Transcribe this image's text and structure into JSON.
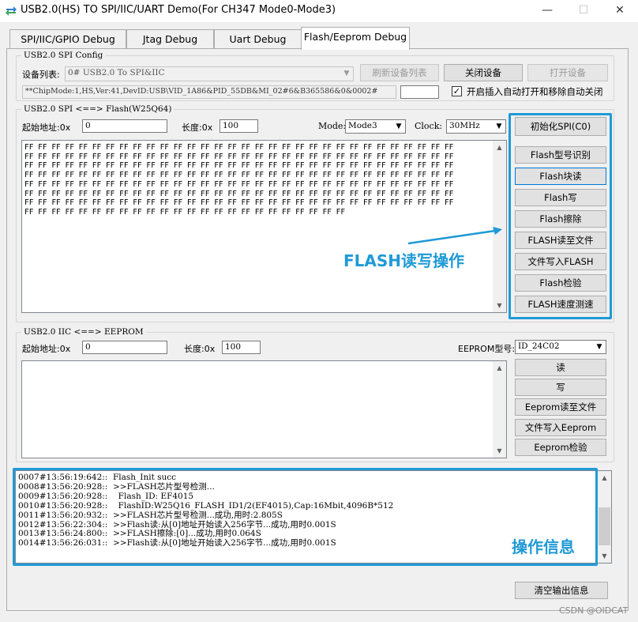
{
  "window": {
    "title": "USB2.0(HS) TO SPI/IIC/UART Demo(For CH347 Mode0-Mode3)",
    "minimize_glyph": "—",
    "maximize_glyph": "☐",
    "close_glyph": "✕"
  },
  "tabs": [
    {
      "label": "SPI/IIC/GPIO Debug",
      "active": false
    },
    {
      "label": "Jtag Debug",
      "active": false
    },
    {
      "label": "Uart Debug",
      "active": false
    },
    {
      "label": "Flash/Eeprom Debug",
      "active": true
    }
  ],
  "spi_config": {
    "group_title": "USB2.0 SPI Config",
    "device_list_label": "设备列表:",
    "device_selected": "0# USB2.0 To SPI&IIC",
    "refresh_button": "刷新设备列表",
    "close_button": "关闭设备",
    "open_button": "打开设备",
    "device_info": "**ChipMode:1,HS,Ver:41,DevID:USB\\VID_1A86&PID_55DB&MI_02#6&B365586&0&0002#",
    "device_info_extra": "",
    "auto_open_checked": true,
    "auto_open_label": "开启插入自动打开和移除自动关闭"
  },
  "spi_flash": {
    "group_title": "USB2.0 SPI <==> Flash(W25Q64)",
    "start_addr_label": "起始地址:0x",
    "start_addr_value": "0",
    "length_label": "长度:0x",
    "length_value": "100",
    "mode_label": "Mode:",
    "mode_value": "Mode3",
    "clock_label": "Clock:",
    "clock_value": "30MHz",
    "data_lines": [
      "FF FF FF FF FF FF FF FF FF FF FF FF FF FF FF FF FF FF FF FF FF FF FF FF FF FF FF FF FF FF FF FF",
      "FF FF FF FF FF FF FF FF FF FF FF FF FF FF FF FF FF FF FF FF FF FF FF FF FF FF FF FF FF FF FF FF",
      "FF FF FF FF FF FF FF FF FF FF FF FF FF FF FF FF FF FF FF FF FF FF FF FF FF FF FF FF FF FF FF FF",
      "FF FF FF FF FF FF FF FF FF FF FF FF FF FF FF FF FF FF FF FF FF FF FF FF FF FF FF FF FF FF FF FF",
      "FF FF FF FF FF FF FF FF FF FF FF FF FF FF FF FF FF FF FF FF FF FF FF FF FF FF FF FF FF FF FF FF",
      "FF FF FF FF FF FF FF FF FF FF FF FF FF FF FF FF FF FF FF FF FF FF FF FF FF FF FF FF FF FF FF FF",
      "FF FF FF FF FF FF FF FF FF FF FF FF FF FF FF FF FF FF FF FF FF FF FF FF FF FF FF FF FF FF FF FF",
      "FF FF FF FF FF FF FF FF FF FF FF FF FF FF FF FF FF FF FF FF FF FF FF FF"
    ],
    "buttons": [
      "初始化SPI(C0)",
      "Flash型号识别",
      "Flash块读",
      "Flash写",
      "Flash擦除",
      "FLASH读至文件",
      "文件写入FLASH",
      "Flash检验",
      "FLASH速度测速"
    ],
    "annotation": "FLASH读写操作"
  },
  "iic_eeprom": {
    "group_title": "USB2.0 IIC <==> EEPROM",
    "start_addr_label": "起始地址:0x",
    "start_addr_value": "0",
    "length_label": "长度:0x",
    "length_value": "100",
    "type_label": "EEPROM型号:",
    "type_value": "ID_24C02",
    "buttons": [
      "读",
      "写",
      "Eeprom读至文件",
      "文件写入Eeprom",
      "Eeprom检验"
    ]
  },
  "log": {
    "lines": [
      "0007#13:56:19:642::  Flash_Init succ",
      "0008#13:56:20:928::  >>FLASH芯片型号检测...",
      "0009#13:56:20:928::    Flash_ID: EF4015",
      "0010#13:56:20:928::    FlashID:W25Q16_FLASH_ID1/2(EF4015),Cap:16Mbit,4096B*512",
      "0011#13:56:20:932::  >>FLASH芯片型号检测...成功,用时:2.805S",
      "0012#13:56:22:304::  >>Flash读:从[0]地址开始读入256字节...成功,用时0.001S",
      "0013#13:56:24:800::  >>FLASH擦除:[0]...成功,用时0.064S",
      "0014#13:56:26:031::  >>Flash读:从[0]地址开始读入256字节...成功,用时0.001S"
    ],
    "annotation": "操作信息",
    "clear_button": "清空输出信息"
  },
  "watermark": "CSDN @OIDCAT",
  "colors": {
    "highlight": "#1f9ad6",
    "window_bg": "#f0f0f0",
    "focus_border": "#0078d7"
  }
}
